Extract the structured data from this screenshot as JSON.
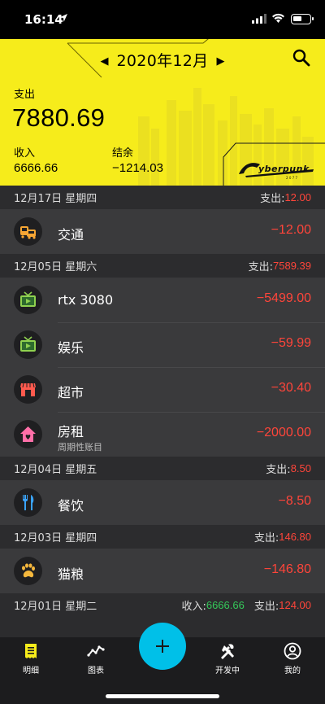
{
  "status_bar": {
    "time": "16:14"
  },
  "header": {
    "month": "2020年12月",
    "spend_label": "支出",
    "spend_total": "7880.69",
    "income_label": "收入",
    "income_value": "6666.66",
    "balance_label": "结余",
    "balance_value": "−1214.03",
    "brand_colors": {
      "background": "#f6ec1b",
      "accent": "#00c0e8",
      "expense": "#ff453a",
      "income": "#34c759"
    }
  },
  "days": [
    {
      "date": "12月17日  星期四",
      "spend_label": "支出:",
      "spend": "12.00",
      "entries": [
        {
          "name": "交通",
          "amount": "−12.00",
          "icon": "car-icon"
        }
      ]
    },
    {
      "date": "12月05日  星期六",
      "spend_label": "支出:",
      "spend": "7589.39",
      "entries": [
        {
          "name": "rtx 3080",
          "amount": "−5499.00",
          "icon": "tv-icon"
        },
        {
          "name": "娱乐",
          "amount": "−59.99",
          "icon": "tv-icon"
        },
        {
          "name": "超市",
          "amount": "−30.40",
          "icon": "store-icon"
        },
        {
          "name": "房租",
          "sub": "周期性账目",
          "amount": "−2000.00",
          "icon": "house-icon"
        }
      ]
    },
    {
      "date": "12月04日  星期五",
      "spend_label": "支出:",
      "spend": "8.50",
      "entries": [
        {
          "name": "餐饮",
          "amount": "−8.50",
          "icon": "cutlery-icon"
        }
      ]
    },
    {
      "date": "12月03日  星期四",
      "spend_label": "支出:",
      "spend": "146.80",
      "entries": [
        {
          "name": "猫粮",
          "amount": "−146.80",
          "icon": "paw-icon"
        }
      ]
    },
    {
      "date": "12月01日  星期二",
      "income_label": "收入:",
      "income": "6666.66",
      "spend_label": "支出:",
      "spend": "124.00",
      "entries": []
    }
  ],
  "tabs": [
    {
      "label": "明细",
      "icon": "list-icon"
    },
    {
      "label": "图表",
      "icon": "chart-icon"
    },
    {
      "label": "开发中",
      "icon": "tools-icon"
    },
    {
      "label": "我的",
      "icon": "user-icon"
    }
  ]
}
